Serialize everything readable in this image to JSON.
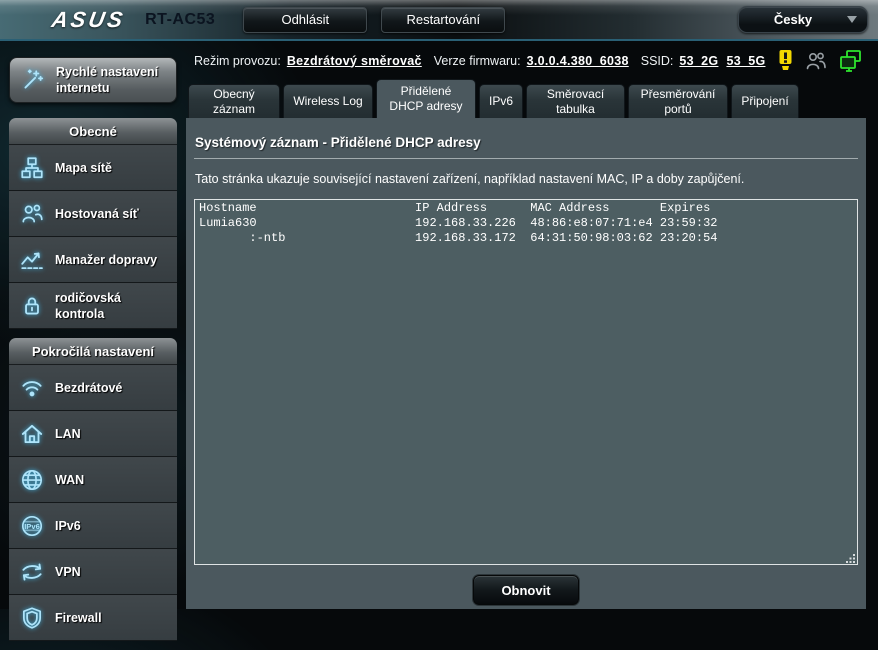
{
  "colors": {
    "accent_cyan": "#aee4fa",
    "topbar_separator": "#2a6075",
    "panel_bg": "#4b585e",
    "textarea_bg": "#4d5e62",
    "warning_yellow": "#f2d800",
    "status_green": "#2ee52e"
  },
  "header": {
    "brand": "ASUS",
    "model": "RT-AC53",
    "logout_label": "Odhlásit",
    "reboot_label": "Restartování",
    "language": {
      "selected": "Česky",
      "icon": "chevron-down-icon"
    }
  },
  "statusbar": {
    "mode_label": "Režim provozu:",
    "mode_value": "Bezdrátový směrovač",
    "firmware_label": "Verze firmwaru:",
    "firmware_value": "3.0.0.4.380_6038",
    "ssid_label": "SSID:",
    "ssid_2g": "53_2G",
    "ssid_5g": "53_5G",
    "icons": [
      "warning-lamp-icon",
      "clients-icon",
      "wired-clients-icon"
    ]
  },
  "sidebar": {
    "quick_setup": {
      "label": "Rychlé nastavení internetu",
      "icon": "magic-wand-icon"
    },
    "sections": [
      {
        "title": "Obecné",
        "items": [
          {
            "label": "Mapa sítě",
            "icon": "network-map-icon"
          },
          {
            "label": "Hostovaná síť",
            "icon": "guest-network-icon"
          },
          {
            "label": "Manažer dopravy",
            "icon": "traffic-manager-icon"
          },
          {
            "label": "rodičovská kontrola",
            "icon": "parental-control-icon"
          }
        ]
      },
      {
        "title": "Pokročilá nastavení",
        "items": [
          {
            "label": "Bezdrátové",
            "icon": "wireless-icon"
          },
          {
            "label": "LAN",
            "icon": "lan-home-icon"
          },
          {
            "label": "WAN",
            "icon": "wan-globe-icon"
          },
          {
            "label": "IPv6",
            "icon": "ipv6-icon"
          },
          {
            "label": "VPN",
            "icon": "vpn-arrows-icon"
          },
          {
            "label": "Firewall",
            "icon": "firewall-shield-icon"
          }
        ]
      }
    ]
  },
  "tabs": [
    {
      "label": "Obecný záznam",
      "active": false
    },
    {
      "label": "Wireless Log",
      "active": false
    },
    {
      "label": "Přidělené DHCP adresy",
      "active": true
    },
    {
      "label": "IPv6",
      "active": false
    },
    {
      "label": "Směrovací tabulka",
      "active": false
    },
    {
      "label": "Přesměrování portů",
      "active": false
    },
    {
      "label": "Připojení",
      "active": false
    }
  ],
  "main": {
    "title": "Systémový záznam - Přidělené DHCP adresy",
    "description": "Tato stránka ukazuje související nastavení zařízení, například nastavení MAC, IP a doby zapůjčení.",
    "log_table": {
      "headers": [
        "Hostname",
        "IP Address",
        "MAC Address",
        "Expires"
      ],
      "rows": [
        [
          "Lumia630",
          "192.168.33.226",
          "48:86:e8:07:71:e4",
          "23:59:32"
        ],
        [
          ":-ntb",
          "192.168.33.172",
          "64:31:50:98:03:62",
          "23:20:54"
        ]
      ]
    },
    "log_text": "Hostname                      IP Address      MAC Address       Expires\nLumia630                      192.168.33.226  48:86:e8:07:71:e4 23:59:32\n       :-ntb                  192.168.33.172  64:31:50:98:03:62 23:20:54",
    "refresh_label": "Obnovit"
  }
}
